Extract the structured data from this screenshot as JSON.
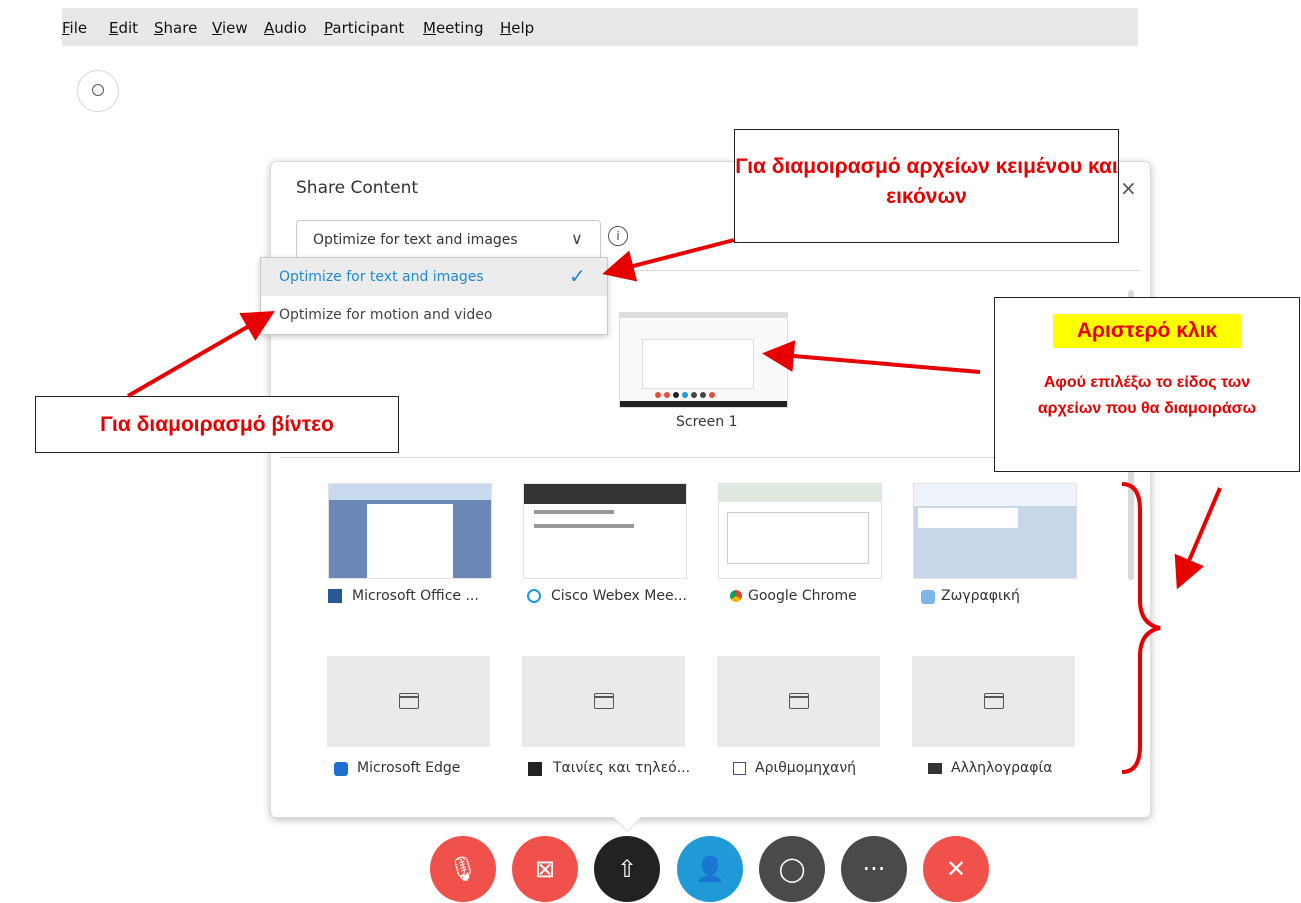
{
  "menu": [
    "File",
    "Edit",
    "Share",
    "View",
    "Audio",
    "Participant",
    "Meeting",
    "Help"
  ],
  "panel": {
    "title": "Share Content",
    "close_glyph": "×",
    "selected_option": "Optimize for text and images",
    "options": [
      "Optimize for text and images",
      "Optimize for motion and video"
    ],
    "info_glyph": "i",
    "chevron_glyph": "∨",
    "check_glyph": "✓"
  },
  "screen": {
    "label": "Screen 1"
  },
  "apps": [
    {
      "label": "Microsoft Office ...",
      "icon": "word-icon"
    },
    {
      "label": "Cisco Webex Mee...",
      "icon": "webex-icon"
    },
    {
      "label": "Google Chrome",
      "icon": "chrome-icon"
    },
    {
      "label": "Ζωγραφική",
      "icon": "paint-icon"
    },
    {
      "label": "Microsoft Edge",
      "icon": "edge-icon"
    },
    {
      "label": "Ταινίες και τηλεό...",
      "icon": "movies-icon"
    },
    {
      "label": "Αριθμομηχανή",
      "icon": "calculator-icon"
    },
    {
      "label": "Αλληλογραφία",
      "icon": "mail-icon"
    }
  ],
  "controls": [
    {
      "name": "mute-button",
      "glyph": "🎙",
      "color": "#f0514b"
    },
    {
      "name": "video-button",
      "glyph": "⊠",
      "color": "#f0514b"
    },
    {
      "name": "share-button",
      "glyph": "⇧",
      "color": "#222222"
    },
    {
      "name": "participants-button",
      "glyph": "👤",
      "color": "#1f9ad6"
    },
    {
      "name": "chat-button",
      "glyph": "◯",
      "color": "#4a4a4a"
    },
    {
      "name": "more-button",
      "glyph": "···",
      "color": "#4a4a4a"
    },
    {
      "name": "leave-button",
      "glyph": "✕",
      "color": "#f0514b"
    }
  ],
  "annotations": {
    "text_images": "Για διαμοιρασμό αρχείων κειμένου και εικόνων",
    "video": "Για διαμοιρασμό βίντεο",
    "left_click": "Αριστερό κλικ",
    "after_choose": "Αφού επιλέξω το είδος των αρχείων που θα διαμοιράσω"
  },
  "colors": {
    "annotation_red": "#e60000",
    "highlight_yellow": "#ffff00",
    "accent_blue": "#1e8ad6"
  }
}
